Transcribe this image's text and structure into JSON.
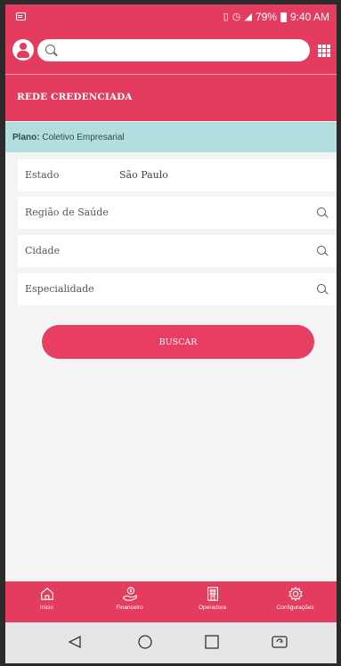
{
  "status_bar": {
    "battery": "79%",
    "time": "9:40 AM",
    "icons": [
      "message-icon",
      "vibrate-icon",
      "alarm-icon",
      "signal-icon",
      "battery-icon"
    ]
  },
  "top_bar": {
    "search_placeholder": "",
    "icons": [
      "avatar-icon",
      "search-icon",
      "apps-grid-icon"
    ]
  },
  "header": {
    "title": "REDE CREDENCIADA"
  },
  "plano": {
    "label": "Plano:",
    "value": "Coletivo Empresarial"
  },
  "form": {
    "estado": {
      "label": "Estado",
      "value": "São Paulo"
    },
    "regiao": {
      "label": "Região de Saúde"
    },
    "cidade": {
      "label": "Cidade"
    },
    "especialidade": {
      "label": "Especialidade"
    },
    "buscar_label": "BUSCAR"
  },
  "bottom_nav": [
    {
      "label": "Inicio",
      "icon": "home-icon"
    },
    {
      "label": "Financeiro",
      "icon": "money-hand-icon"
    },
    {
      "label": "Operadora",
      "icon": "building-icon"
    },
    {
      "label": "Configurações",
      "icon": "settings-icon"
    }
  ],
  "system_nav": [
    "back-icon",
    "home-circle-icon",
    "recents-icon",
    "rotate-icon"
  ],
  "colors": {
    "primary": "#e33c5e",
    "plano_bg": "#b2dedf",
    "page_bg": "#f4f4f4"
  }
}
